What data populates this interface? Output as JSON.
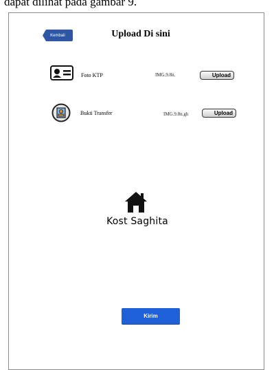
{
  "caption": "dapat dilihat pada gambar 9.",
  "header": {
    "back_label": "Kembali",
    "title": "Upload Di sini"
  },
  "uploads": [
    {
      "label": "Foto KTP",
      "filename": "IMG.9.8n.",
      "button": "Upload"
    },
    {
      "label": "Bukti Transfer",
      "filename": "IMG.9.8n.gh",
      "button": "Upload"
    }
  ],
  "brand": {
    "name": "Kost Saghita"
  },
  "submit": {
    "label": "Kirim"
  }
}
